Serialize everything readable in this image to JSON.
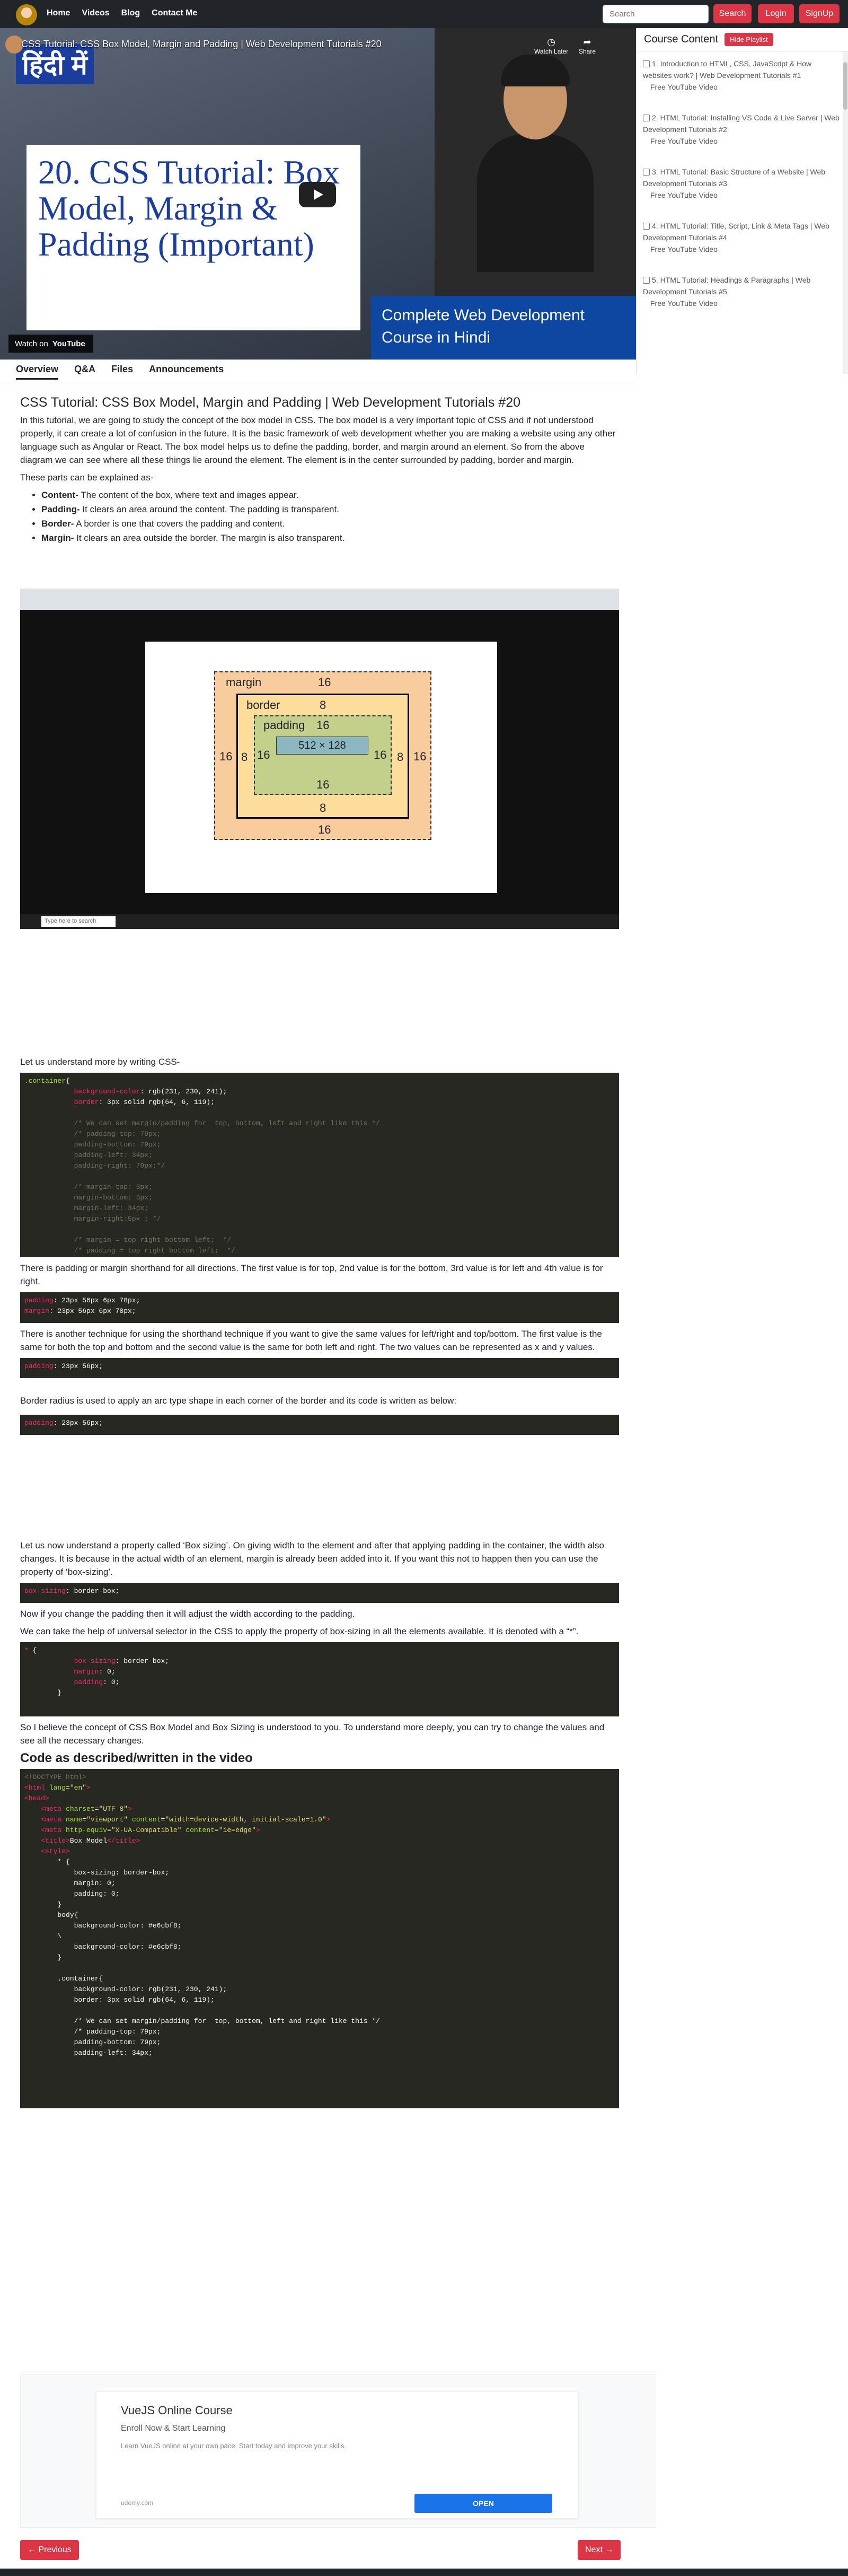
{
  "nav": {
    "links": [
      "Home",
      "Videos",
      "Blog",
      "Contact Me"
    ],
    "search_placeholder": "Search",
    "search_btn": "Search",
    "login": "Login",
    "signup": "SignUp"
  },
  "video": {
    "yt_title": "CSS Tutorial: CSS Box Model, Margin and Padding | Web Development Tutorials #20",
    "hindi": "हिंदी में",
    "thumb_title": "20. CSS Tutorial: Box Model, Margin & Padding (Important)",
    "band": "Complete Web Development Course in Hindi",
    "watch_later": "Watch Later",
    "share": "Share",
    "watch_on": "Watch on",
    "youtube": "YouTube"
  },
  "sidebar": {
    "title": "Course Content",
    "hide_btn": "Hide Playlist",
    "items": [
      {
        "title": "1. Introduction to HTML, CSS, JavaScript & How websites work? | Web Development Tutorials #1",
        "sub": "Free YouTube Video"
      },
      {
        "title": "2. HTML Tutorial: Installing VS Code & Live Server | Web Development Tutorials #2",
        "sub": "Free YouTube Video"
      },
      {
        "title": "3. HTML Tutorial: Basic Structure of a Website | Web Development Tutorials #3",
        "sub": "Free YouTube Video"
      },
      {
        "title": "4. HTML Tutorial: Title, Script, Link & Meta Tags | Web Development Tutorials #4",
        "sub": "Free YouTube Video"
      },
      {
        "title": "5. HTML Tutorial: Headings & Paragraphs | Web Development Tutorials #5",
        "sub": "Free YouTube Video"
      }
    ]
  },
  "tabs": [
    "Overview",
    "Q&A",
    "Files",
    "Announcements"
  ],
  "article": {
    "title": "CSS Tutorial: CSS Box Model, Margin and Padding | Web Development Tutorials #20",
    "p1": "In this tutorial, we are going to study the concept of the box model in CSS. The box model is a very important topic of CSS and if not understood properly, it can create a lot of confusion in the future. It is the basic framework of web development whether you are making a website using any other language such as Angular or React. The box model helps us to define the padding, border, and margin around an element. So from the above diagram we can see where all these things lie around the element. The element is in the center surrounded by padding, border and margin.",
    "p2": "These parts can be explained as-",
    "list": [
      {
        "b": "Content-",
        "t": " The content of the box, where text and images appear."
      },
      {
        "b": "Padding-",
        "t": " It clears an area around the content. The padding is transparent."
      },
      {
        "b": "Border-",
        "t": " A border is one that covers the padding and content."
      },
      {
        "b": "Margin-",
        "t": " It clears an area outside the border. The margin is also transparent."
      }
    ],
    "p3": "Let us understand more by writing CSS-",
    "p4": "There is padding or margin shorthand for all directions. The first value is for top, 2nd value is for the bottom, 3rd value is for left and 4th value is for right.",
    "p5": "There is another technique for using the shorthand technique if you want to give the same values for left/right and top/bottom. The first value is the same for both the top and bottom and the second value is the same for both left and right. The two values can be represented as x and y values.",
    "p6": "Border radius is used to apply an arc type shape in each corner of the border and its code is written as below:",
    "p7": "Let us now understand a property called ‘Box sizing’. On giving width to the element and after that applying padding in the container, the width also changes. It is because in the actual width of an element, margin is already been added into it. If you want this not to happen then you can use the property of ‘box-sizing’.",
    "p8": "Now if you change the padding then it will adjust the width according to the padding.",
    "p9": "We can take the help of universal selector in the CSS to apply the property of box-sizing in all the elements available. It is denoted with a “*”.",
    "p10": "So I believe the concept of CSS Box Model and Box Sizing is understood to you. To understand more deeply, you can try to change the values and see all the necessary changes.",
    "h2": "Code as described/written in the video"
  },
  "diagram": {
    "margin": "margin",
    "border": "border",
    "padding": "padding",
    "content": "512 × 128",
    "v16": "16",
    "v8": "8",
    "search": "Type here to search"
  },
  "ad": {
    "title": "VueJS Online Course",
    "sub": "Enroll Now & Start Learning",
    "desc": "Learn VueJS online at your own pace. Start today and improve your skills.",
    "domain": "udemy.com",
    "open": "OPEN"
  },
  "pager": {
    "prev": "← Previous",
    "next": "Next →"
  }
}
